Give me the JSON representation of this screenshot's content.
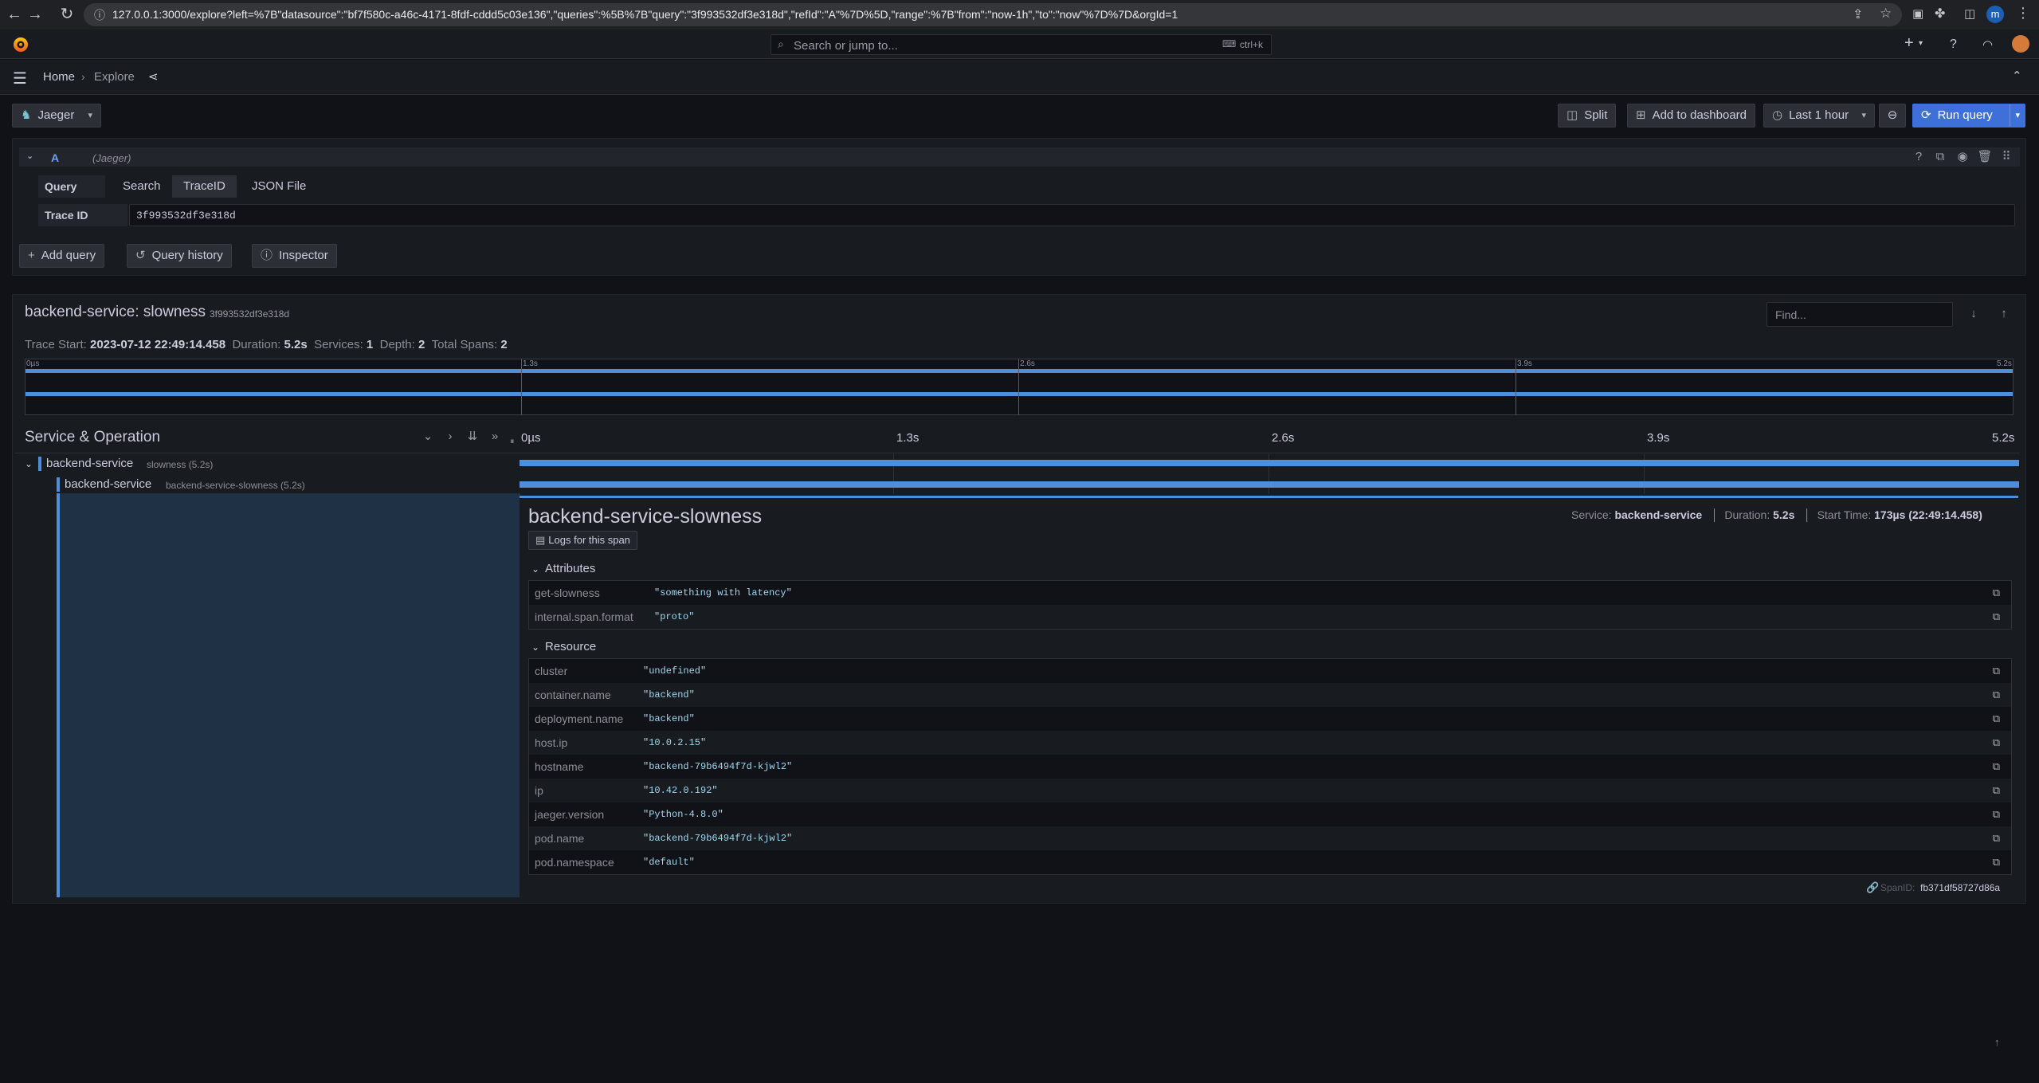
{
  "browser": {
    "url": "127.0.0.1:3000/explore?left=%7B\"datasource\":\"bf7f580c-a46c-4171-8fdf-cddd5c03e136\",\"queries\":%5B%7B\"query\":\"3f993532df3e318d\",\"refId\":\"A\"%7D%5D,\"range\":%7B\"from\":\"now-1h\",\"to\":\"now\"%7D%7D&orgId=1",
    "profile_initial": "m"
  },
  "topbar": {
    "search_placeholder": "Search or jump to...",
    "shortcut": "ctrl+k",
    "plus_label": "+"
  },
  "breadcrumb": {
    "home": "Home",
    "explore": "Explore"
  },
  "toolbar": {
    "datasource": "Jaeger",
    "split": "Split",
    "add_to_dashboard": "Add to dashboard",
    "time_range": "Last 1 hour",
    "run_query": "Run query"
  },
  "query": {
    "ref_id": "A",
    "datasource_tag": "(Jaeger)",
    "query_type_label": "Query type",
    "query_types": [
      "Search",
      "TraceID",
      "JSON File"
    ],
    "selected_type": "TraceID",
    "trace_id_label": "Trace ID",
    "trace_id_value": "3f993532df3e318d",
    "add_query": "Add query",
    "query_history": "Query history",
    "inspector": "Inspector"
  },
  "trace": {
    "title": "backend-service: slowness",
    "trace_id": "3f993532df3e318d",
    "find_placeholder": "Find...",
    "meta": {
      "trace_start_label": "Trace Start:",
      "trace_start": "2023-07-12 22:49:14.458",
      "duration_label": "Duration:",
      "duration": "5.2s",
      "services_label": "Services:",
      "services": "1",
      "depth_label": "Depth:",
      "depth": "2",
      "total_spans_label": "Total Spans:",
      "total_spans": "2"
    },
    "minimap_ticks": [
      "0µs",
      "1.3s",
      "2.6s",
      "3.9s",
      "5.2s"
    ],
    "header": "Service & Operation",
    "timeline_ticks": [
      "0µs",
      "1.3s",
      "2.6s",
      "3.9s",
      "5.2s"
    ],
    "spans": [
      {
        "service": "backend-service",
        "operation": "slowness (5.2s)"
      },
      {
        "service": "backend-service",
        "operation": "backend-service-slowness (5.2s)"
      }
    ]
  },
  "span_detail": {
    "title": "backend-service-slowness",
    "service_label": "Service:",
    "service": "backend-service",
    "duration_label": "Duration:",
    "duration": "5.2s",
    "start_label": "Start Time:",
    "start": "173µs (22:49:14.458)",
    "logs_link": "Logs for this span",
    "attributes_header": "Attributes",
    "attributes": [
      {
        "key": "get-slowness",
        "value": "\"something with latency\""
      },
      {
        "key": "internal.span.format",
        "value": "\"proto\""
      }
    ],
    "resource_header": "Resource",
    "resource": [
      {
        "key": "cluster",
        "value": "\"undefined\""
      },
      {
        "key": "container.name",
        "value": "\"backend\""
      },
      {
        "key": "deployment.name",
        "value": "\"backend\""
      },
      {
        "key": "host.ip",
        "value": "\"10.0.2.15\""
      },
      {
        "key": "hostname",
        "value": "\"backend-79b6494f7d-kjwl2\""
      },
      {
        "key": "ip",
        "value": "\"10.42.0.192\""
      },
      {
        "key": "jaeger.version",
        "value": "\"Python-4.8.0\""
      },
      {
        "key": "pod.name",
        "value": "\"backend-79b6494f7d-kjwl2\""
      },
      {
        "key": "pod.namespace",
        "value": "\"default\""
      }
    ],
    "span_id_label": "SpanID:",
    "span_id": "fb371df58727d86a"
  },
  "colors": {
    "accent": "#3d71d9",
    "span_bar": "#4f8fd9",
    "background": "#111217",
    "panel": "#181b1f"
  }
}
